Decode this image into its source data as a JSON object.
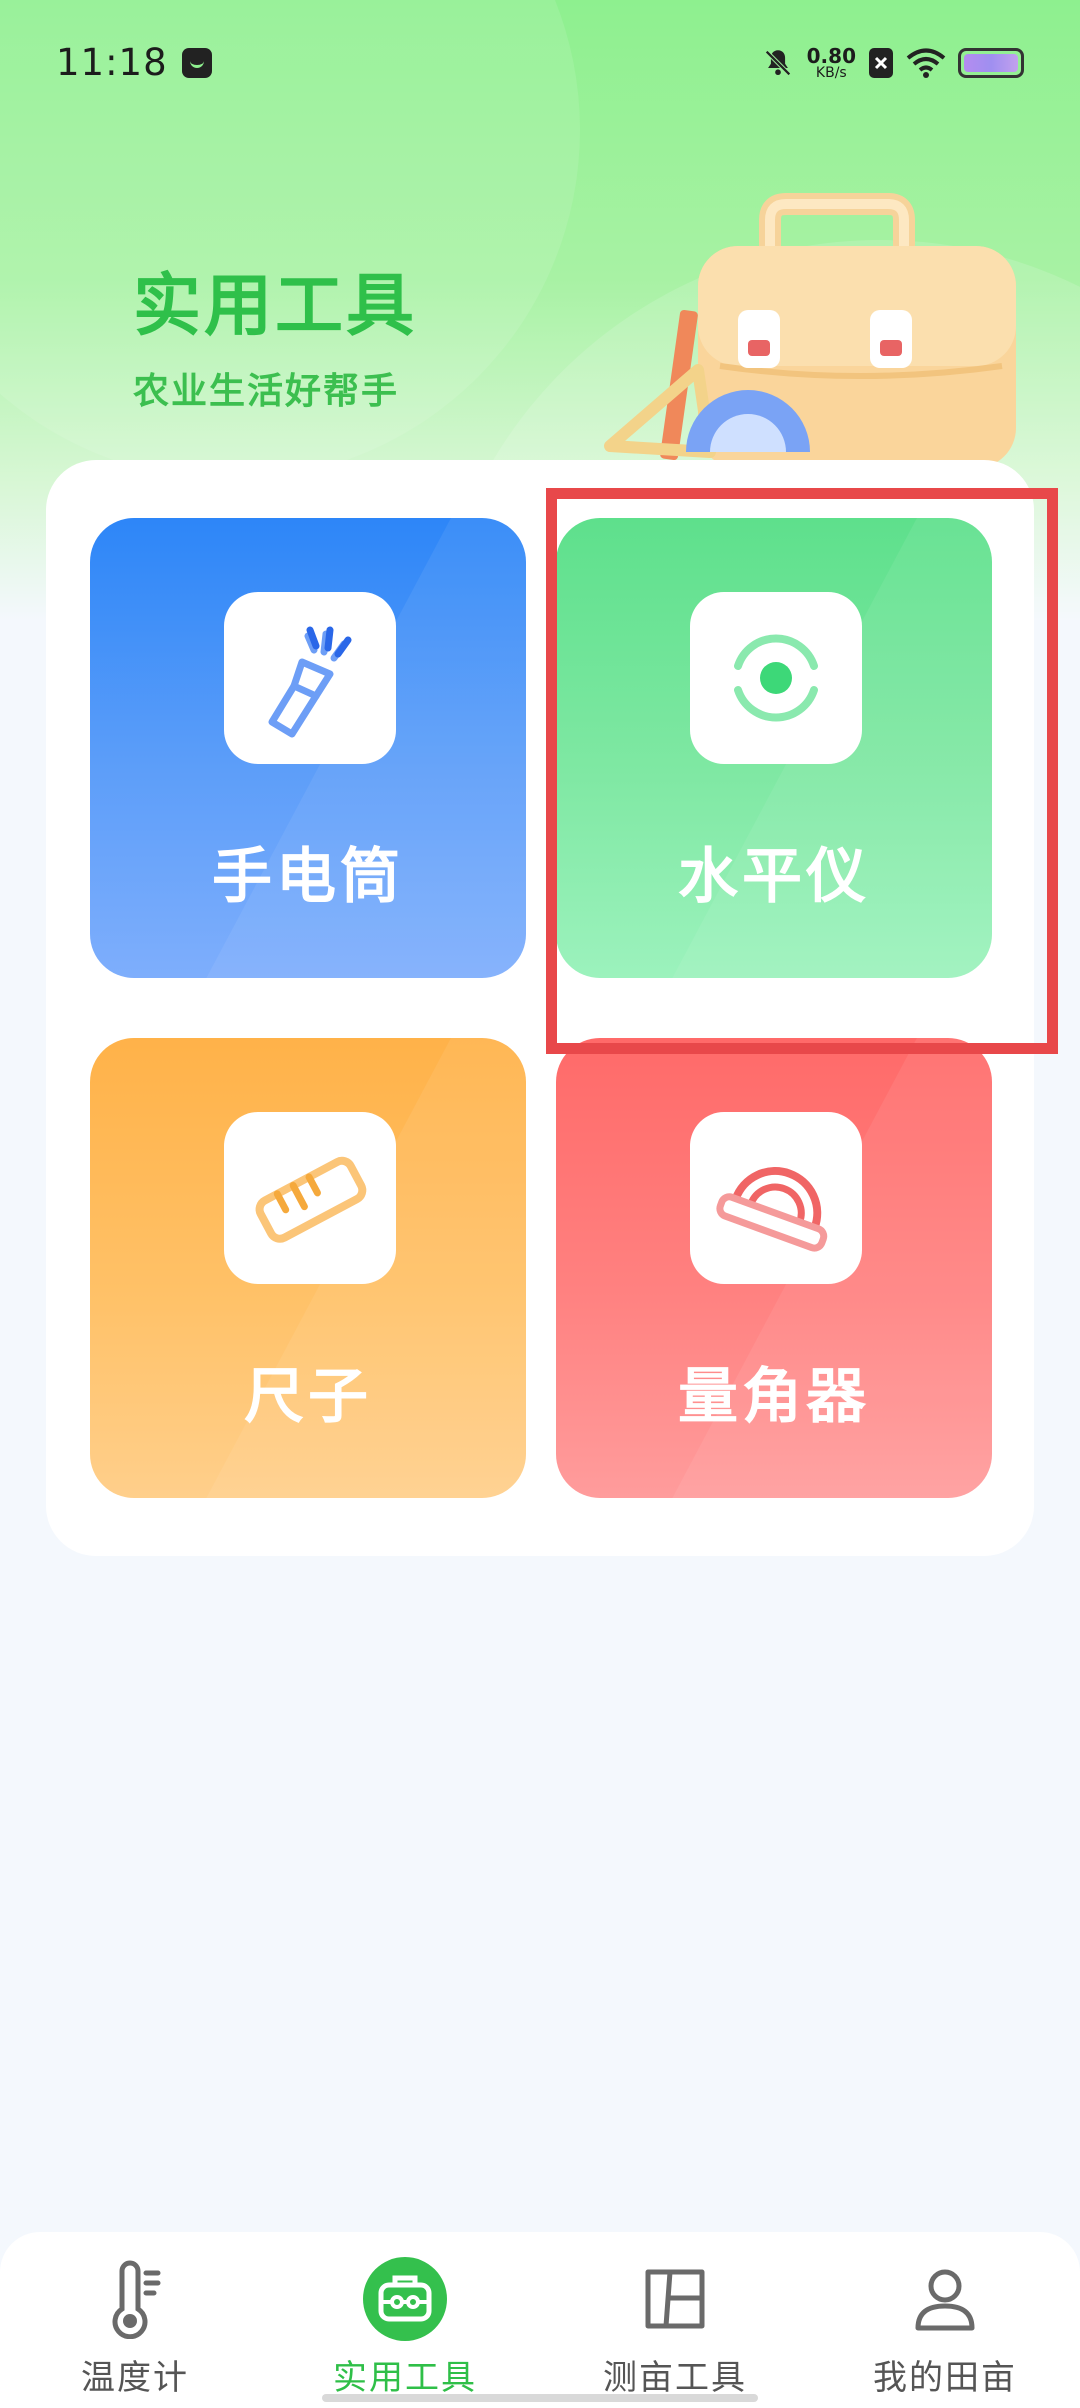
{
  "status_bar": {
    "time": "11:18",
    "net_speed_value": "0.80",
    "net_speed_unit": "KB/s"
  },
  "header": {
    "title": "实用工具",
    "subtitle": "农业生活好帮手"
  },
  "tools": [
    {
      "label": "手电筒",
      "icon": "flashlight-icon",
      "color": "#2d86f8"
    },
    {
      "label": "水平仪",
      "icon": "level-icon",
      "color": "#5ee08c"
    },
    {
      "label": "尺子",
      "icon": "ruler-icon",
      "color": "#ffb249"
    },
    {
      "label": "量角器",
      "icon": "protractor-icon",
      "color": "#ff6a69"
    }
  ],
  "bottom_nav": [
    {
      "label": "温度计",
      "icon": "thermometer-icon",
      "active": false
    },
    {
      "label": "实用工具",
      "icon": "toolbox-icon",
      "active": true
    },
    {
      "label": "测亩工具",
      "icon": "field-measure-icon",
      "active": false
    },
    {
      "label": "我的田亩",
      "icon": "person-icon",
      "active": false
    }
  ],
  "colors": {
    "accent_green": "#2fc04a",
    "highlight_red": "#e8484a"
  }
}
